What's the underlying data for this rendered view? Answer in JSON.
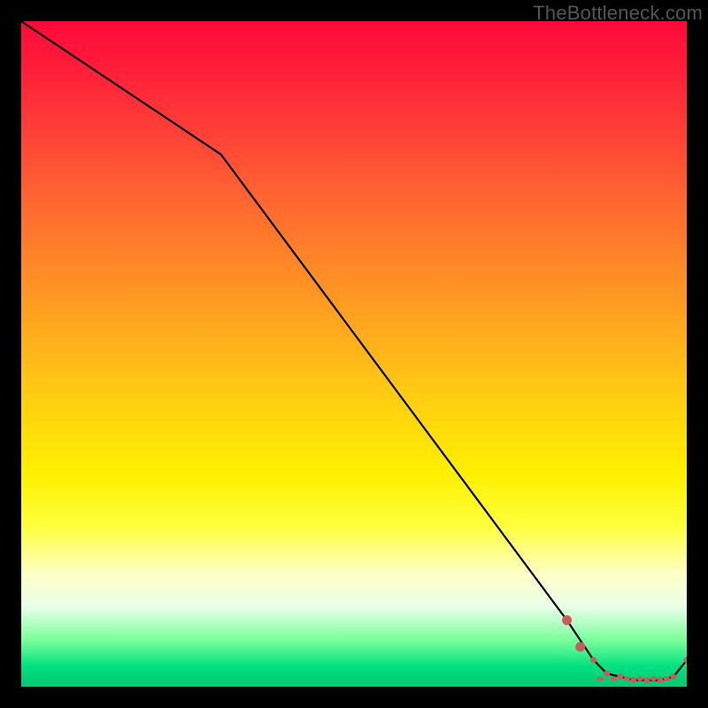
{
  "watermark": "TheBottleneck.com",
  "colors": {
    "line": "#000000",
    "marker": "#cc5a5a",
    "frame_bg_top": "#ff0a3a",
    "frame_bg_bottom": "#00c870",
    "page_bg": "#000000"
  },
  "chart_data": {
    "type": "line",
    "title": "",
    "xlabel": "",
    "ylabel": "",
    "xlim": [
      0,
      100
    ],
    "ylim": [
      0,
      100
    ],
    "grid": false,
    "legend": false,
    "series": [
      {
        "name": "curve",
        "x": [
          0,
          30,
          82,
          86,
          88,
          90,
          92,
          94,
          96,
          98,
          100
        ],
        "y": [
          100,
          80,
          10,
          4,
          2,
          1.5,
          1,
          1,
          1,
          1.5,
          4
        ]
      }
    ],
    "markers": {
      "name": "highlight",
      "x": [
        82,
        84,
        86,
        88,
        90,
        92,
        94,
        96,
        98,
        100
      ],
      "y": [
        10,
        6,
        4,
        2,
        1.5,
        1,
        1,
        1,
        1.5,
        4
      ]
    },
    "dashes": {
      "x_pairs": [
        [
          86,
          88
        ],
        [
          88,
          90
        ],
        [
          90,
          92
        ],
        [
          92,
          94
        ],
        [
          94,
          96
        ],
        [
          96,
          98
        ]
      ],
      "y": 1.2
    }
  }
}
